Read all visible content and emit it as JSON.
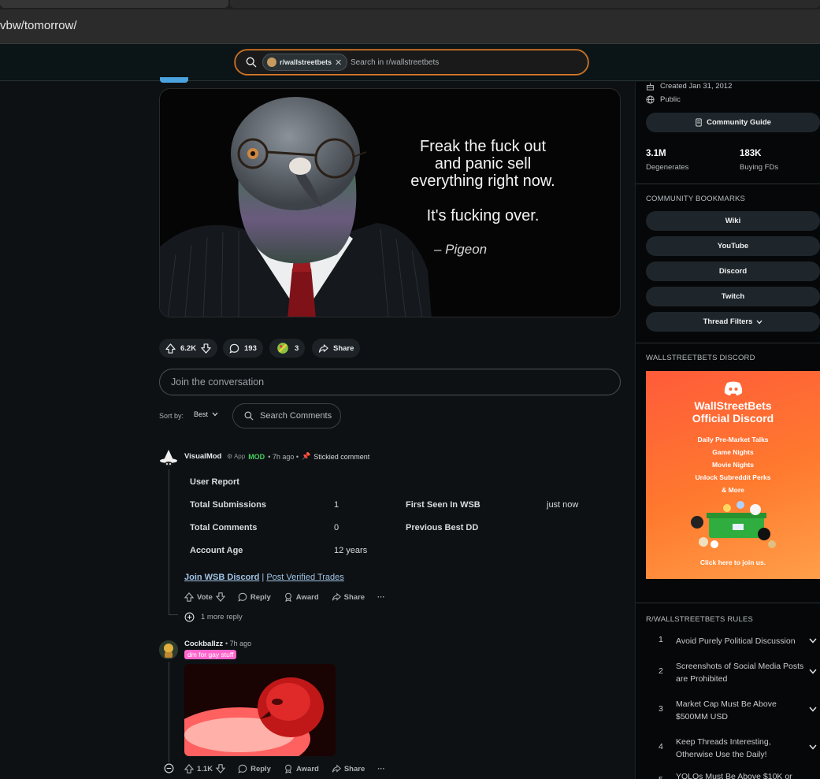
{
  "browser": {
    "url_fragment": "vbw/tomorrow/"
  },
  "search": {
    "subreddit_chip": "r/wallstreetbets",
    "placeholder": "Search in r/wallstreetbets"
  },
  "post": {
    "quote_line1": "Freak the fuck out",
    "quote_line2": "and panic sell",
    "quote_line3": "everything right now.",
    "quote_line4": "It's fucking over.",
    "quote_attribution": "– Pigeon",
    "votes": "6.2K",
    "comments": "193",
    "awards": "3",
    "share_label": "Share"
  },
  "comment_box": {
    "placeholder": "Join the conversation"
  },
  "sort": {
    "label": "Sort by:",
    "value": "Best",
    "search_label": "Search Comments"
  },
  "comments": [
    {
      "author": "VisualMod",
      "app_tag": "App",
      "mod_tag": "MOD",
      "time": "• 7h ago •",
      "stickied": "Stickied comment",
      "report_title": "User Report",
      "report_rows": {
        "total_submissions_label": "Total Submissions",
        "total_submissions": "1",
        "first_seen_label": "First Seen In WSB",
        "first_seen": "just now",
        "total_comments_label": "Total Comments",
        "total_comments": "0",
        "prev_dd_label": "Previous Best DD",
        "account_age_label": "Account Age",
        "account_age": "12 years"
      },
      "link1": "Join WSB Discord",
      "separator": "|",
      "link2": "Post Verified Trades",
      "actions": {
        "vote": "Vote",
        "reply": "Reply",
        "award": "Award",
        "share": "Share",
        "more": "···"
      },
      "more_replies": "1 more reply"
    },
    {
      "author": "Cockballzz",
      "time": "• 7h ago",
      "flair": "dm for gay stuff",
      "actions": {
        "votes": "1.1K",
        "reply": "Reply",
        "award": "Award",
        "share": "Share",
        "more": "···"
      }
    }
  ],
  "sidebar": {
    "created": "Created Jan 31, 2012",
    "visibility": "Public",
    "guide_button": "Community Guide",
    "members_value": "3.1M",
    "members_label": "Degenerates",
    "online_value": "183K",
    "online_label": "Buying FDs",
    "bookmarks_heading": "COMMUNITY BOOKMARKS",
    "bookmarks": [
      "Wiki",
      "YouTube",
      "Discord",
      "Twitch",
      "Thread Filters"
    ],
    "discord_heading": "WALLSTREETBETS DISCORD",
    "ad": {
      "title1": "WallStreetBets",
      "title2": "Official Discord",
      "lines": [
        "Daily Pre-Market Talks",
        "Game Nights",
        "Movie Nights",
        "Unlock Subreddit Perks",
        "& More"
      ],
      "cta": "Click here to join us."
    },
    "rules_heading": "R/WALLSTREETBETS RULES",
    "rules": [
      {
        "n": "1",
        "text": "Avoid Purely Political Discussion"
      },
      {
        "n": "2",
        "text": "Screenshots of Social Media Posts are Prohibited"
      },
      {
        "n": "3",
        "text": "Market Cap Must Be Above $500MM USD"
      },
      {
        "n": "4",
        "text": "Keep Threads Interesting, Otherwise Use the Daily!"
      },
      {
        "n": "5",
        "text": "YOLOs Must Be Above $10K or"
      }
    ]
  },
  "colors": {
    "accent_orange": "#d9822b",
    "mod_green": "#46d160",
    "flair_pink": "#ff66cc",
    "link_blue": "#a0c4e6"
  }
}
